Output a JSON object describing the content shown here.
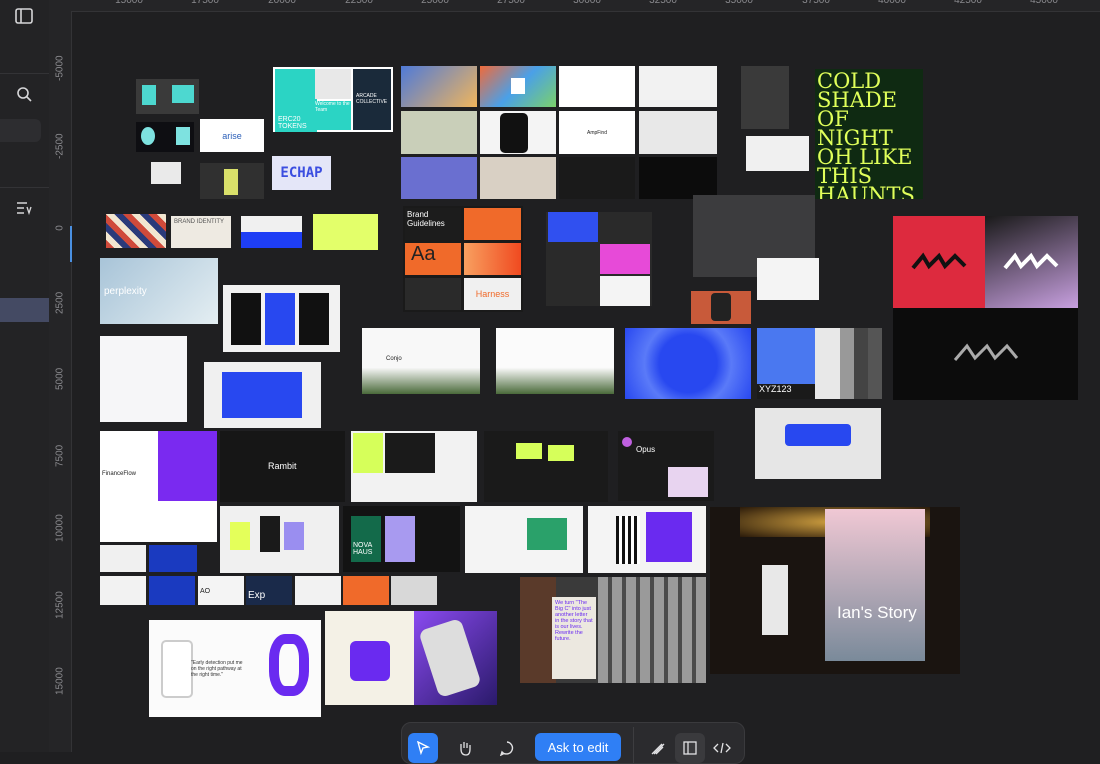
{
  "ruler": {
    "top_ticks": [
      "15000",
      "17500",
      "20000",
      "22500",
      "25000",
      "27500",
      "30000",
      "32500",
      "35000",
      "37500",
      "40000",
      "42500",
      "45000"
    ],
    "left_ticks": [
      "-5000",
      "-2500",
      "0",
      "2500",
      "5000",
      "7500",
      "10000",
      "12500",
      "15000"
    ]
  },
  "sidebar": {
    "icons": [
      "panel-toggle-icon",
      "search-icon",
      "list-filter-icon"
    ]
  },
  "canvas_text": {
    "erc20": "ERC20 TOKENS",
    "arise": "arise",
    "echap": "ECHAP",
    "welcome": "Welcome to the Team",
    "arcade": "ARCADE COLLECTIVE",
    "cold": "COLD SHADE OF NIGHT OH LIKE THIS HAUNTS ME STILL",
    "brand_identity": "BRAND IDENTITY",
    "brand_guidelines": "Brand Guidelines",
    "harness": "Harness",
    "aa": "Aa",
    "perplexity": "perplexity",
    "conjo": "Conjo",
    "xyz": "XYZ123",
    "rambit": "Rambit",
    "opus": "Opus",
    "financeflow": "FinanceFlow",
    "nova": "NOVA HAUS",
    "big_c": "We turn \"The Big C\" into just another letter in the story that is our lives. Rewrite the future.",
    "ians_story": "Ian's Story",
    "early": "\"Early detection put me on the right pathway at the right time.\"",
    "exp": "Exp",
    "ao": "AO",
    "flow_left": "Flowmode",
    "ampfind": "AmpFind"
  },
  "toolbar": {
    "ask_label": "Ask to edit",
    "tools": [
      "pointer-tool-icon",
      "hand-tool-icon",
      "comment-tool-icon",
      "draw-tool-icon",
      "design-mode-icon",
      "code-view-icon"
    ]
  },
  "colors": {
    "accent": "#2f7ff5",
    "canvas_bg": "#1f1f21",
    "sidebar_active": "#444a63"
  }
}
